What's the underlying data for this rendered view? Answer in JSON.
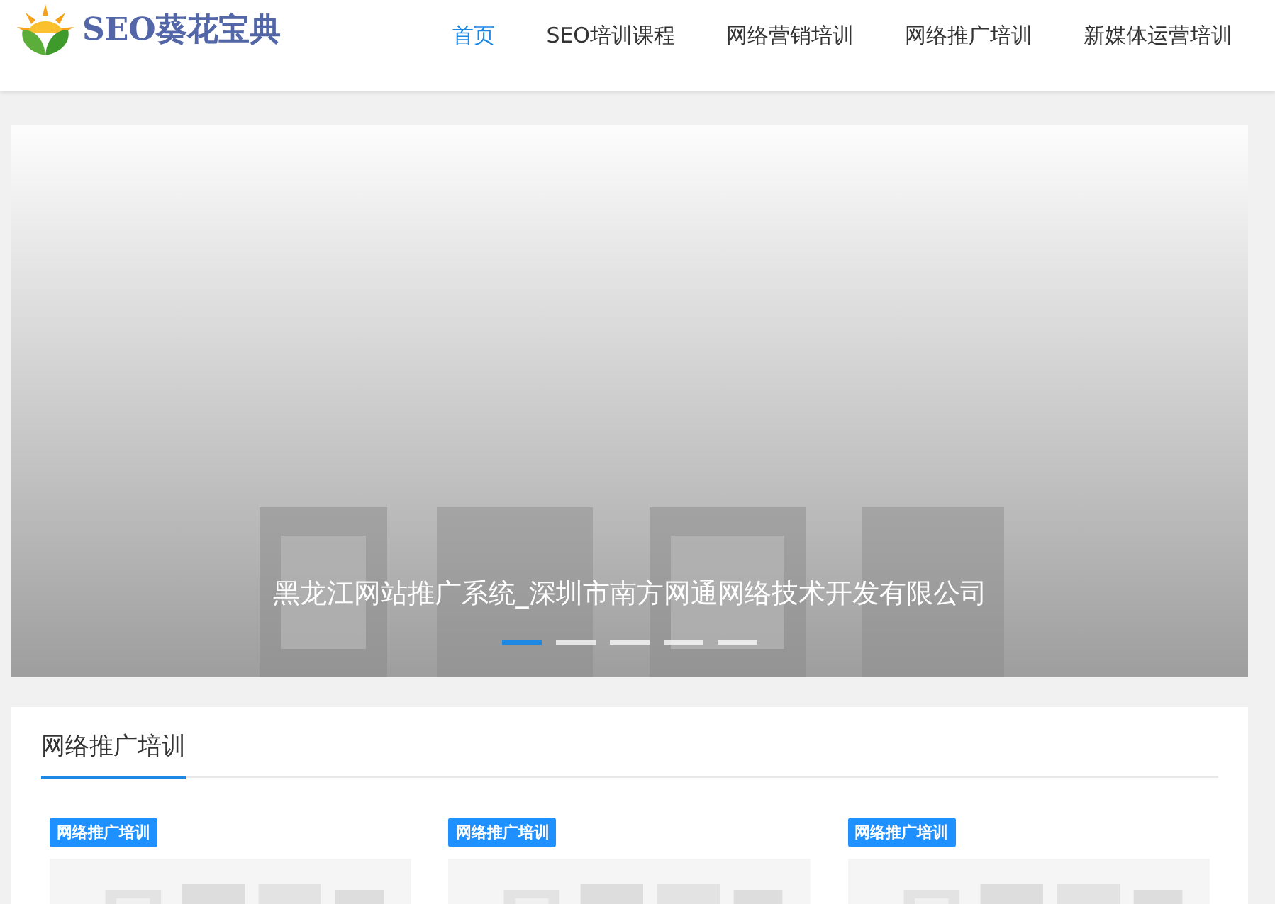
{
  "header": {
    "logo_text": "SEO葵花宝典",
    "nav": [
      {
        "label": "首页",
        "selected": true
      },
      {
        "label": "SEO培训课程",
        "selected": false
      },
      {
        "label": "网络营销培训",
        "selected": false
      },
      {
        "label": "网络推广培训",
        "selected": false
      },
      {
        "label": "新媒体运营培训",
        "selected": false
      }
    ]
  },
  "slider": {
    "caption": "黑龙江网站推广系统_深圳市南方网通网络技术开发有限公司",
    "dots": [
      {
        "selected": true
      },
      {
        "selected": false
      },
      {
        "selected": false
      },
      {
        "selected": false
      },
      {
        "selected": false
      }
    ]
  },
  "section": {
    "title": "网络推广培训",
    "cards": [
      {
        "tag": "网络推广培训",
        "kind": "picture"
      },
      {
        "tag": "网络推广培训",
        "kind": "picture"
      },
      {
        "tag": "网络推广培训",
        "kind": "picture"
      }
    ]
  }
}
